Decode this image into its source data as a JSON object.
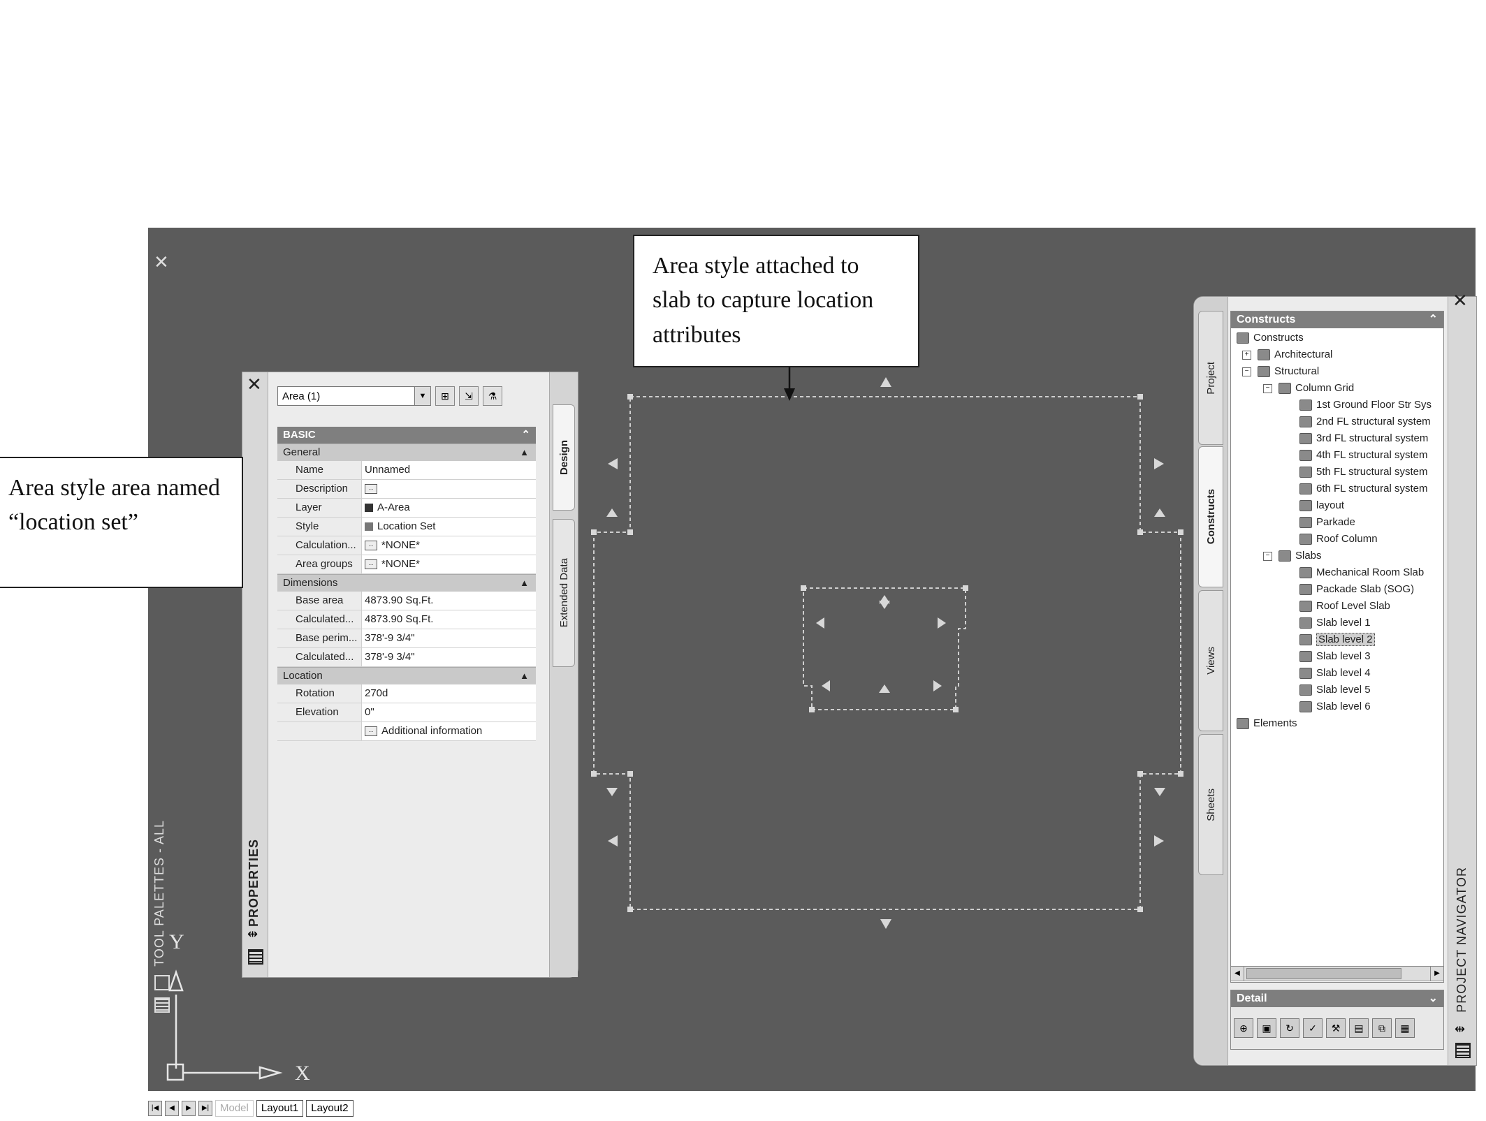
{
  "side_palette": {
    "title": "TOOL PALETTES - ALL",
    "close": "✕"
  },
  "properties": {
    "title": "PROPERTIES",
    "close": "✕",
    "selection": "Area (1)",
    "tabs": [
      "Design",
      "Extended Data"
    ],
    "basic_header": "BASIC",
    "general_header": "General",
    "general_rows": [
      {
        "key": "Name",
        "value": "Unnamed"
      },
      {
        "key": "Description",
        "value": ""
      },
      {
        "key": "Layer",
        "value": "A-Area"
      },
      {
        "key": "Style",
        "value": "Location Set"
      },
      {
        "key": "Calculation...",
        "value": "*NONE*"
      },
      {
        "key": "Area groups",
        "value": "*NONE*"
      }
    ],
    "dimensions_header": "Dimensions",
    "dimensions_rows": [
      {
        "key": "Base area",
        "value": "4873.90 Sq.Ft."
      },
      {
        "key": "Calculated...",
        "value": "4873.90 Sq.Ft."
      },
      {
        "key": "Base perim...",
        "value": "378'-9 3/4\""
      },
      {
        "key": "Calculated...",
        "value": "378'-9 3/4\""
      }
    ],
    "location_header": "Location",
    "location_rows": [
      {
        "key": "Rotation",
        "value": "270d"
      },
      {
        "key": "Elevation",
        "value": "0\""
      }
    ],
    "additional_info": "Additional information"
  },
  "navigator": {
    "title": "PROJECT NAVIGATOR",
    "close": "✕",
    "tabs": [
      "Project",
      "Constructs",
      "Views",
      "Sheets"
    ],
    "tree_header": "Constructs",
    "tree": [
      {
        "label": "Constructs",
        "level": 0,
        "toggle": ""
      },
      {
        "label": "Architectural",
        "level": 1,
        "toggle": "+"
      },
      {
        "label": "Structural",
        "level": 1,
        "toggle": "−"
      },
      {
        "label": "Column Grid",
        "level": 2,
        "toggle": "−"
      },
      {
        "label": "1st Ground Floor Str Sys",
        "level": 3,
        "toggle": ""
      },
      {
        "label": "2nd FL structural system",
        "level": 3,
        "toggle": ""
      },
      {
        "label": "3rd FL structural system",
        "level": 3,
        "toggle": ""
      },
      {
        "label": "4th FL structural system",
        "level": 3,
        "toggle": ""
      },
      {
        "label": "5th FL structural system",
        "level": 3,
        "toggle": ""
      },
      {
        "label": "6th FL structural system",
        "level": 3,
        "toggle": ""
      },
      {
        "label": "layout",
        "level": 3,
        "toggle": ""
      },
      {
        "label": "Parkade",
        "level": 3,
        "toggle": ""
      },
      {
        "label": "Roof Column",
        "level": 3,
        "toggle": ""
      },
      {
        "label": "Slabs",
        "level": 2,
        "toggle": "−"
      },
      {
        "label": "Mechanical Room Slab",
        "level": 3,
        "toggle": ""
      },
      {
        "label": "Packade Slab (SOG)",
        "level": 3,
        "toggle": ""
      },
      {
        "label": "Roof Level Slab",
        "level": 3,
        "toggle": ""
      },
      {
        "label": "Slab level 1",
        "level": 3,
        "toggle": ""
      },
      {
        "label": "Slab level 2",
        "level": 3,
        "toggle": "",
        "highlighted": true
      },
      {
        "label": "Slab level 3",
        "level": 3,
        "toggle": ""
      },
      {
        "label": "Slab level 4",
        "level": 3,
        "toggle": ""
      },
      {
        "label": "Slab level 5",
        "level": 3,
        "toggle": ""
      },
      {
        "label": "Slab level 6",
        "level": 3,
        "toggle": ""
      },
      {
        "label": "Elements",
        "level": 0,
        "toggle": ""
      }
    ],
    "detail_header": "Detail"
  },
  "callouts": {
    "top": "Area style attached to slab to capture location attributes",
    "left": "Area style area named “location set”"
  },
  "ucs": {
    "x": "X",
    "y": "Y"
  },
  "layout_tabs": [
    "Model",
    "Layout1",
    "Layout2"
  ]
}
